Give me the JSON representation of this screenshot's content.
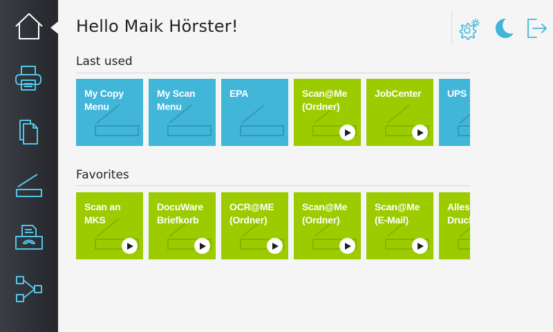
{
  "colors": {
    "accent": "#41b6d9",
    "tile_blue": "#41b6d9",
    "tile_green": "#9ccc00",
    "sidebar": "#2c2f34",
    "icon_outline": "#52c6ea"
  },
  "sidebar": {
    "items": [
      {
        "name": "home",
        "icon": "home-icon",
        "active": true
      },
      {
        "name": "print",
        "icon": "printer-icon",
        "active": false
      },
      {
        "name": "copy",
        "icon": "copy-icon",
        "active": false
      },
      {
        "name": "scan",
        "icon": "scanner-icon",
        "active": false
      },
      {
        "name": "fax",
        "icon": "fax-icon",
        "active": false
      },
      {
        "name": "workflow",
        "icon": "workflow-icon",
        "active": false
      }
    ]
  },
  "header": {
    "greeting": "Hello Maik Hörster!",
    "icons": [
      "settings-icon",
      "night-mode-icon",
      "logout-icon"
    ]
  },
  "last_used": {
    "title": "Last used",
    "tiles": [
      {
        "label": "My Copy\nMenu",
        "color": "blue",
        "play": false
      },
      {
        "label": "My Scan\nMenu",
        "color": "blue",
        "play": false
      },
      {
        "label": "EPA",
        "color": "blue",
        "play": false
      },
      {
        "label": "Scan@Me\n(Ordner)",
        "color": "green",
        "play": true
      },
      {
        "label": "JobCenter",
        "color": "green",
        "play": true
      },
      {
        "label": "UPS S",
        "color": "blue",
        "play": false
      }
    ]
  },
  "favorites": {
    "title": "Favorites",
    "tiles": [
      {
        "label": "Scan an\nMKS",
        "color": "green",
        "play": true
      },
      {
        "label": "DocuWare\nBriefkorb",
        "color": "green",
        "play": true
      },
      {
        "label": "OCR@ME\n(Ordner)",
        "color": "green",
        "play": true
      },
      {
        "label": "Scan@Me\n(Ordner)",
        "color": "green",
        "play": true
      },
      {
        "label": "Scan@Me\n(E-Mail)",
        "color": "green",
        "play": true
      },
      {
        "label": "Alles\nDruck",
        "color": "green",
        "play": false
      }
    ]
  }
}
